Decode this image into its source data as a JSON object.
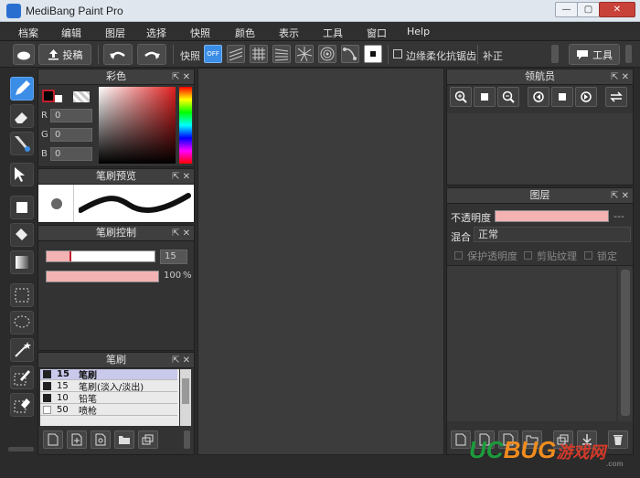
{
  "window": {
    "title": "MediBang Paint Pro",
    "min": "—",
    "max": "▢",
    "close": "✕"
  },
  "menu": [
    "档案",
    "编辑",
    "图层",
    "选择",
    "快照",
    "颜色",
    "表示",
    "工具",
    "窗口",
    "Help"
  ],
  "toolbar": {
    "post_label": "投稿",
    "snap_label": "快照",
    "snap_toggle": "OFF",
    "antialias_label": "边缘柔化抗锯齿",
    "correction_label": "补正",
    "tools_label": "工具"
  },
  "color_panel": {
    "title": "彩色",
    "r_label": "R",
    "r_value": "0",
    "g_label": "G",
    "g_value": "0",
    "b_label": "B",
    "b_value": "0",
    "fg_color": "#000000",
    "bg_color": "#ffffff",
    "accent": "#c0202c"
  },
  "brush_preview": {
    "title": "笔刷预览"
  },
  "brush_control": {
    "title": "笔刷控制",
    "size_value": "15",
    "opacity_value": "100",
    "opacity_unit": "%"
  },
  "brush_list": {
    "title": "笔刷",
    "items": [
      {
        "size": "15",
        "name": "笔刷"
      },
      {
        "size": "15",
        "name": "笔刷(淡入/淡出)"
      },
      {
        "size": "10",
        "name": "铅笔"
      },
      {
        "size": "50",
        "name": "喷枪"
      }
    ]
  },
  "navigator": {
    "title": "领航员"
  },
  "layers": {
    "title": "图层",
    "opacity_label": "不透明度",
    "opacity_value": "---",
    "blend_label": "混合",
    "blend_value": "正常",
    "protect_label": "保护透明度",
    "clip_label": "剪贴纹理",
    "lock_label": "锁定"
  },
  "watermark": {
    "part1": "UC",
    "part2": "BUG",
    "part3": "游戏网",
    "sub": ".com"
  }
}
